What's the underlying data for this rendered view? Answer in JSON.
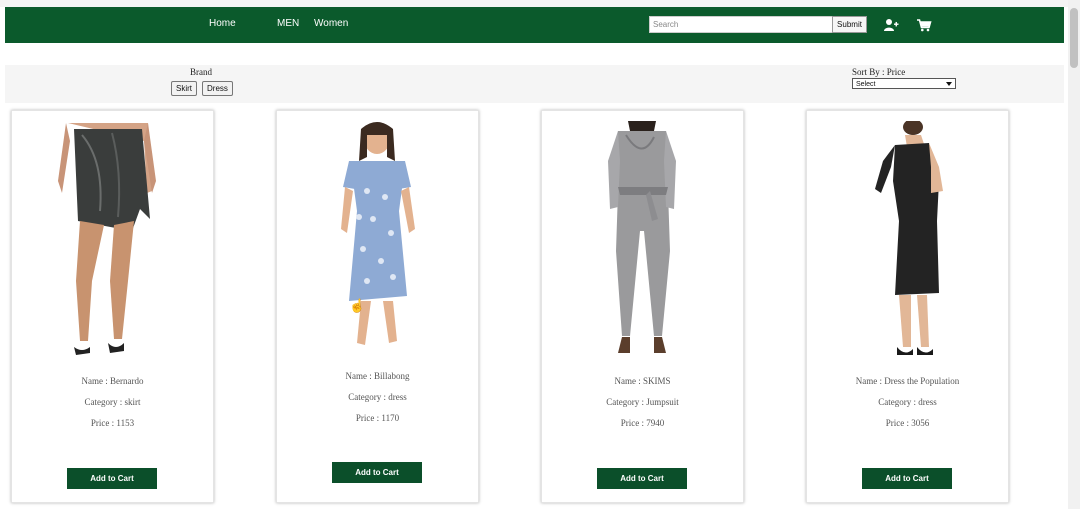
{
  "nav": {
    "links": [
      "Home",
      "MEN",
      "Women"
    ],
    "search_placeholder": "Search",
    "submit_label": "Submit",
    "icons": [
      "add-user-icon",
      "cart-icon"
    ],
    "color": "#0b5a2c"
  },
  "filters": {
    "brand_title": "Brand",
    "brand_options": [
      "Skirt",
      "Dress"
    ],
    "sort_title": "Sort By : Price",
    "sort_selected": "Select"
  },
  "products": [
    {
      "name": "Name : Bernardo",
      "category": "Category : skirt",
      "price": "Price : 1153",
      "button": "Add to Cart",
      "image": "black-leather-skirt"
    },
    {
      "name": "Name : Billabong",
      "category": "Category : dress",
      "price": "Price : 1170",
      "button": "Add to Cart",
      "image": "blue-floral-dress"
    },
    {
      "name": "Name : SKIMS",
      "category": "Category : Jumpsuit",
      "price": "Price : 7940",
      "button": "Add to Cart",
      "image": "silver-satin-jumpsuit"
    },
    {
      "name": "Name : Dress the Population",
      "category": "Category : dress",
      "price": "Price : 3056",
      "button": "Add to Cart",
      "image": "black-one-shoulder-dress"
    }
  ]
}
